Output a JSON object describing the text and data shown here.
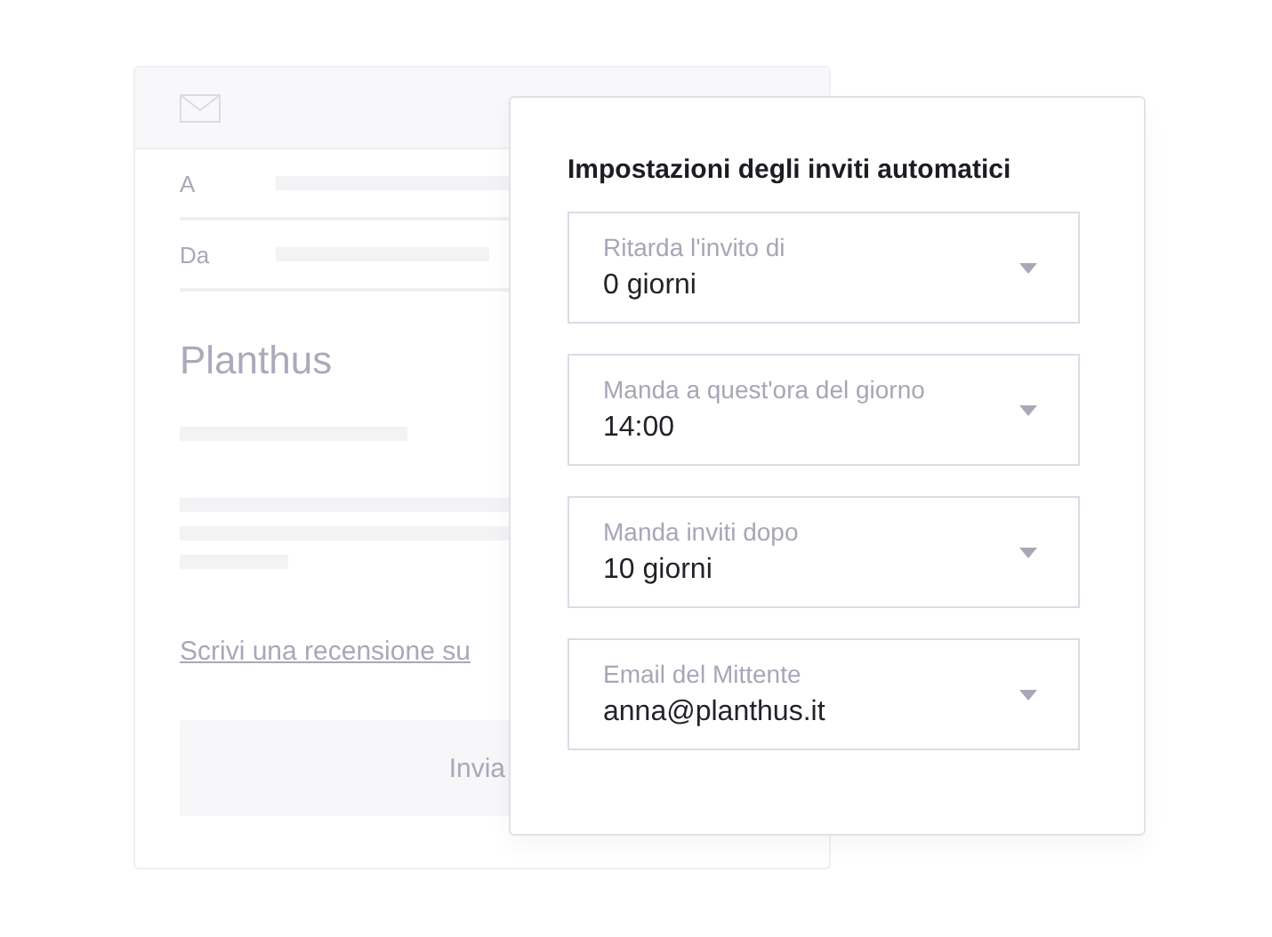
{
  "email_preview": {
    "fields": [
      {
        "label": "A"
      },
      {
        "label": "Da"
      }
    ],
    "brand": "Planthus",
    "review_link": "Scrivi una recensione su",
    "send_button": "Invia"
  },
  "settings_panel": {
    "title": "Impostazioni degli inviti automatici",
    "fields": [
      {
        "kind": "dropdown",
        "label": "Ritarda l'invito di",
        "value": "0 giorni"
      },
      {
        "kind": "dropdown",
        "label": "Manda a quest'ora del giorno",
        "value": "14:00"
      },
      {
        "kind": "dropdown",
        "label": "Manda inviti dopo",
        "value": "10 giorni"
      },
      {
        "kind": "dropdown",
        "label": "Email del Mittente",
        "value": "anna@planthus.it"
      }
    ]
  }
}
